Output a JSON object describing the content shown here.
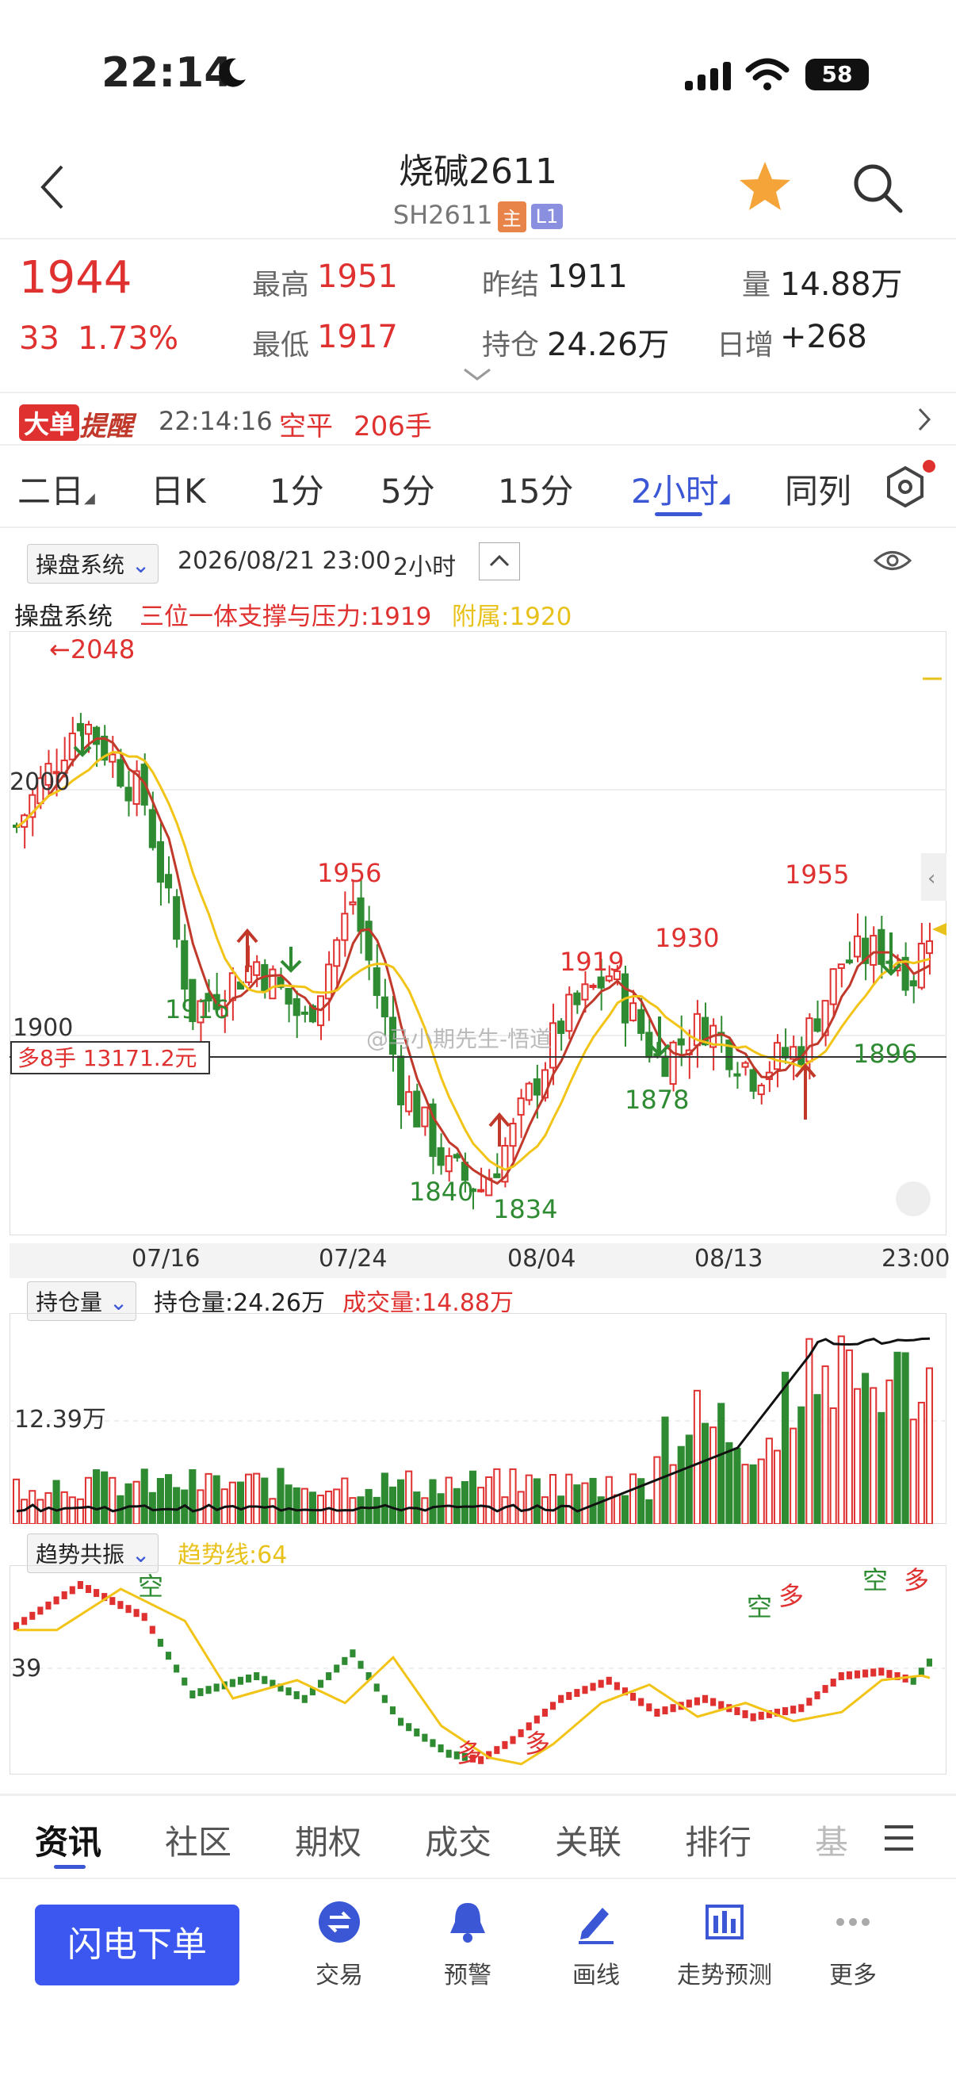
{
  "status_bar": {
    "time": "22:14",
    "battery": "58"
  },
  "header": {
    "title": "烧碱2611",
    "symbol": "SH2611",
    "tag_main": "主",
    "tag_level": "L1"
  },
  "quote": {
    "price": "1944",
    "change": "33",
    "change_pct": "1.73%",
    "high_label": "最高",
    "high": "1951",
    "low_label": "最低",
    "low": "1917",
    "prev_settle_label": "昨结",
    "prev_settle": "1911",
    "open_interest_label": "持仓",
    "open_interest": "24.26万",
    "volume_label": "量",
    "volume": "14.88万",
    "daily_increase_label": "日增",
    "daily_increase": "+268"
  },
  "alert": {
    "badge_a": "大单",
    "badge_b": "提醒",
    "time": "22:14:16",
    "type": "空平",
    "amount": "206手"
  },
  "period_tabs": [
    "二日",
    "日K",
    "1分",
    "5分",
    "15分",
    "2小时",
    "同列"
  ],
  "active_period": "2小时",
  "chart_toolbar": {
    "system": "操盘系统",
    "datetime": "2026/08/21 23:00",
    "period": "2小时"
  },
  "indicator_legend": {
    "name": "操盘系统",
    "main": "三位一体支撑与压力:1919",
    "aux": "附属:1920"
  },
  "watermark": "@马小期先生-悟道",
  "chart_data": {
    "type": "candlestick",
    "y_axis_labels": [
      "2000",
      "1900"
    ],
    "x_axis_labels": [
      "07/16",
      "07/24",
      "08/04",
      "08/13",
      "23:00"
    ],
    "high_marker": "←2048",
    "annotations": {
      "highs": [
        "1956",
        "1919",
        "1930",
        "1955"
      ],
      "lows": [
        "1916",
        "1840",
        "1834",
        "1878",
        "1896"
      ]
    },
    "position_label": "多8手 13171.2元",
    "colors": {
      "up": "#e03131",
      "down": "#2e8b32",
      "ma_fast": "#c0392b",
      "ma_slow": "#f2c418"
    }
  },
  "volume_panel": {
    "selector": "持仓量",
    "oi_label": "持仓量:24.26万",
    "vol_label": "成交量:14.88万",
    "axis_label": "12.39万"
  },
  "trend_panel": {
    "selector": "趋势共振",
    "line_label": "趋势线:64",
    "axis_label": "39",
    "marks": [
      "空",
      "多",
      "多",
      "空",
      "多",
      "空",
      "多"
    ]
  },
  "bottom_tabs": [
    "资讯",
    "社区",
    "期权",
    "成交",
    "关联",
    "排行",
    "基"
  ],
  "active_bottom_tab": "资讯",
  "action_bar": {
    "primary": "闪电下单",
    "items": [
      {
        "label": "交易",
        "icon": "trade-icon"
      },
      {
        "label": "预警",
        "icon": "bell-icon"
      },
      {
        "label": "画线",
        "icon": "draw-icon"
      },
      {
        "label": "走势预测",
        "icon": "forecast-icon"
      },
      {
        "label": "更多",
        "icon": "more-icon"
      }
    ]
  }
}
